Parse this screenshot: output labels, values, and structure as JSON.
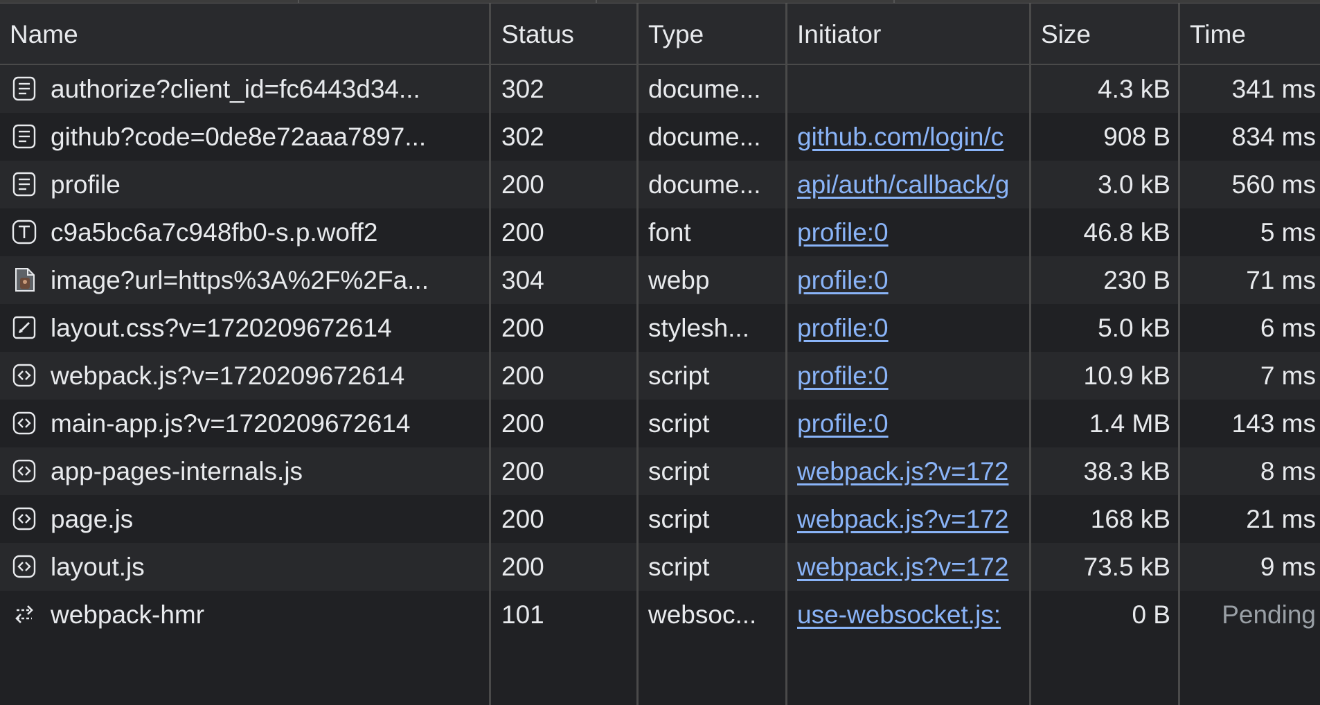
{
  "columns": {
    "name": "Name",
    "status": "Status",
    "type": "Type",
    "initiator": "Initiator",
    "size": "Size",
    "time": "Time"
  },
  "rows": [
    {
      "icon": "document-icon",
      "name": "authorize?client_id=fc6443d34...",
      "status": "302",
      "type": "docume...",
      "initiator": "",
      "size": "4.3 kB",
      "time": "341 ms"
    },
    {
      "icon": "document-icon",
      "name": "github?code=0de8e72aaa7897...",
      "status": "302",
      "type": "docume...",
      "initiator": "github.com/login/c",
      "size": "908 B",
      "time": "834 ms"
    },
    {
      "icon": "document-icon",
      "name": "profile",
      "status": "200",
      "type": "docume...",
      "initiator": "api/auth/callback/g",
      "size": "3.0 kB",
      "time": "560 ms"
    },
    {
      "icon": "font-icon",
      "name": "c9a5bc6a7c948fb0-s.p.woff2",
      "status": "200",
      "type": "font",
      "initiator": "profile:0",
      "size": "46.8 kB",
      "time": "5 ms"
    },
    {
      "icon": "image-icon",
      "name": "image?url=https%3A%2F%2Fa...",
      "status": "304",
      "type": "webp",
      "initiator": "profile:0",
      "size": "230 B",
      "time": "71 ms"
    },
    {
      "icon": "stylesheet-icon",
      "name": "layout.css?v=1720209672614",
      "status": "200",
      "type": "stylesh...",
      "initiator": "profile:0",
      "size": "5.0 kB",
      "time": "6 ms"
    },
    {
      "icon": "script-icon",
      "name": "webpack.js?v=1720209672614",
      "status": "200",
      "type": "script",
      "initiator": "profile:0",
      "size": "10.9 kB",
      "time": "7 ms"
    },
    {
      "icon": "script-icon",
      "name": "main-app.js?v=1720209672614",
      "status": "200",
      "type": "script",
      "initiator": "profile:0",
      "size": "1.4 MB",
      "time": "143 ms"
    },
    {
      "icon": "script-icon",
      "name": "app-pages-internals.js",
      "status": "200",
      "type": "script",
      "initiator": "webpack.js?v=172",
      "size": "38.3 kB",
      "time": "8 ms"
    },
    {
      "icon": "script-icon",
      "name": "page.js",
      "status": "200",
      "type": "script",
      "initiator": "webpack.js?v=172",
      "size": "168 kB",
      "time": "21 ms"
    },
    {
      "icon": "script-icon",
      "name": "layout.js",
      "status": "200",
      "type": "script",
      "initiator": "webpack.js?v=172",
      "size": "73.5 kB",
      "time": "9 ms"
    },
    {
      "icon": "websocket-icon",
      "name": "webpack-hmr",
      "status": "101",
      "type": "websoc...",
      "initiator": "use-websocket.js:",
      "size": "0 B",
      "time": "Pending"
    }
  ],
  "colors": {
    "background": "#202124",
    "row_alt": "#28292c",
    "link": "#8ab4f8",
    "text": "#e8eaed",
    "muted": "#9aa0a6"
  }
}
